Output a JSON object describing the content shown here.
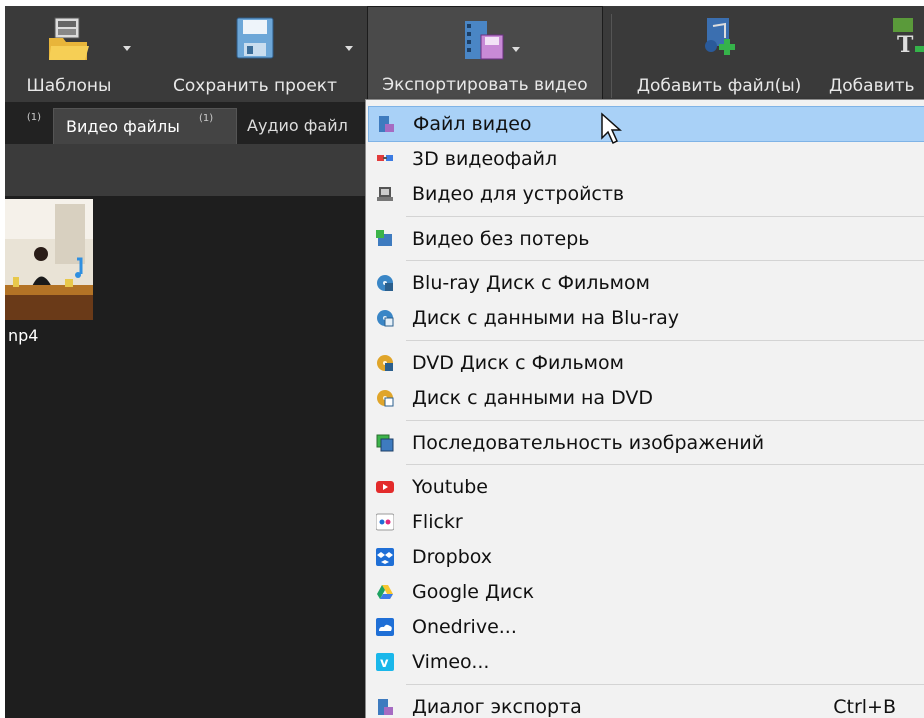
{
  "toolbar": {
    "templates_label": "Шаблоны",
    "save_label": "Сохранить проект",
    "export_label": "Экспортировать видео",
    "add_files_label": "Добавить файл(ы)",
    "add_more_label": "Добавить"
  },
  "tabs": {
    "prev_count": "(1)",
    "video_label": "Видео файлы",
    "video_count": "(1)",
    "audio_label": "Аудио файл"
  },
  "file": {
    "name_fragment": "np4"
  },
  "menu": {
    "items": [
      {
        "label": "Файл видео",
        "icon": "film-file-icon"
      },
      {
        "label": "3D видеофайл",
        "icon": "3d-glasses-icon"
      },
      {
        "label": "Видео для устройств",
        "icon": "devices-icon"
      },
      {
        "label": "Видео без потерь",
        "icon": "lossless-icon"
      },
      {
        "label": "Blu-ray Диск с Фильмом",
        "icon": "bluray-disc-icon"
      },
      {
        "label": "Диск с данными на Blu-ray",
        "icon": "bluray-data-icon"
      },
      {
        "label": "DVD Диск с Фильмом",
        "icon": "dvd-disc-icon"
      },
      {
        "label": "Диск с данными на DVD",
        "icon": "dvd-data-icon"
      },
      {
        "label": "Последовательность изображений",
        "icon": "image-sequence-icon"
      },
      {
        "label": "Youtube",
        "icon": "youtube-icon"
      },
      {
        "label": "Flickr",
        "icon": "flickr-icon"
      },
      {
        "label": "Dropbox",
        "icon": "dropbox-icon"
      },
      {
        "label": "Google Диск",
        "icon": "google-drive-icon"
      },
      {
        "label": "Onedrive...",
        "icon": "onedrive-icon"
      },
      {
        "label": "Vimeo...",
        "icon": "vimeo-icon"
      },
      {
        "label": "Диалог экспорта",
        "icon": "export-dialog-icon",
        "shortcut": "Ctrl+B"
      }
    ]
  },
  "colors": {
    "highlight": "#a9d1f7",
    "toolbar_bg": "#3a3a3a",
    "menu_bg": "#f2f2f2"
  }
}
